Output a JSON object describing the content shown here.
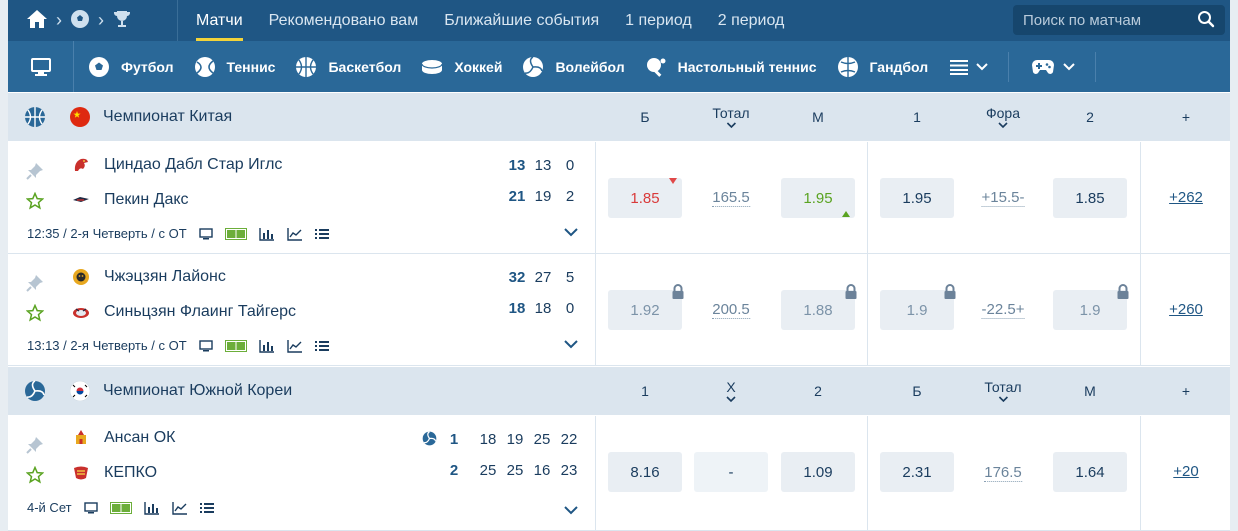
{
  "topnav": {
    "items": [
      "Матчи",
      "Рекомендовано вам",
      "Ближайшие события",
      "1 период",
      "2 период"
    ],
    "search_placeholder": "Поиск по матчам"
  },
  "sports": [
    "Футбол",
    "Теннис",
    "Баскетбол",
    "Хоккей",
    "Волейбол",
    "Настольный теннис",
    "Гандбол"
  ],
  "leagues": [
    {
      "title": "Чемпионат Китая",
      "columns": [
        "Б",
        "Тотал",
        "М",
        "1",
        "Фора",
        "2",
        "+"
      ],
      "matches": [
        {
          "team1": "Циндао Дабл Стар Иглс",
          "team2": "Пекин Дакс",
          "score1": [
            "13",
            "13",
            "0"
          ],
          "score2": [
            "21",
            "19",
            "2"
          ],
          "info": "12:35 / 2-я Четверть / с ОТ",
          "odds": [
            "1.85",
            "165.5",
            "1.95",
            "1.95",
            "+15.5-",
            "1.85"
          ],
          "more": "+262"
        },
        {
          "team1": "Чжэцзян Лайонс",
          "team2": "Синьцзян Флаинг Тайгерс",
          "score1": [
            "32",
            "27",
            "5"
          ],
          "score2": [
            "18",
            "18",
            "0"
          ],
          "info": "13:13 / 2-я Четверть / с ОТ",
          "odds": [
            "1.92",
            "200.5",
            "1.88",
            "1.9",
            "-22.5+",
            "1.9"
          ],
          "more": "+260"
        }
      ]
    },
    {
      "title": "Чемпионат Южной Кореи",
      "columns": [
        "1",
        "X",
        "2",
        "Б",
        "Тотал",
        "М",
        "+"
      ],
      "matches": [
        {
          "team1": "Ансан ОК",
          "team2": "КЕПКО",
          "sets1": "1",
          "sets2": "2",
          "score1": [
            "18",
            "19",
            "25",
            "22"
          ],
          "score2": [
            "25",
            "25",
            "16",
            "23"
          ],
          "info": "4-й Сет",
          "odds": [
            "8.16",
            "-",
            "1.09",
            "2.31",
            "176.5",
            "1.64"
          ],
          "more": "+20"
        }
      ]
    }
  ],
  "colors": {
    "topbar": "#1f5684",
    "sportsbar": "#2a6898",
    "accent": "#f3d33a",
    "league_bg": "#dbe5ee"
  }
}
